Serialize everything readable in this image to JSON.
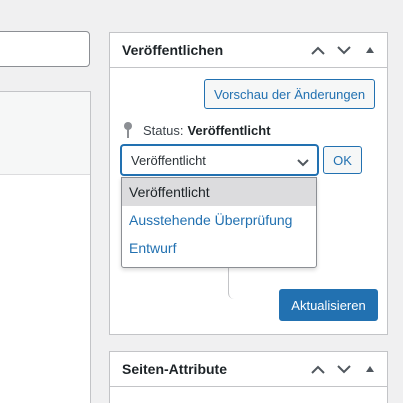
{
  "editor": {},
  "publish_box": {
    "title": "Veröffentlichen",
    "preview_label": "Vorschau der Änderungen",
    "status_label": "Status:",
    "status_value": "Veröffentlicht",
    "select_value": "Veröffentlicht",
    "ok_label": "OK",
    "options": [
      "Veröffentlicht",
      "Ausstehende Überprüfung",
      "Entwurf"
    ],
    "update_label": "Aktualisieren"
  },
  "attributes_box": {
    "title": "Seiten-Attribute"
  },
  "icons": {
    "move_up": "chevron-up-icon",
    "move_down": "chevron-down-icon",
    "toggle": "triangle-up-icon",
    "status": "pin-icon"
  },
  "colors": {
    "accent": "#2271b1",
    "border": "#c3c4c7",
    "background": "#f0f0f1",
    "selected_option": "#dcdcde"
  }
}
